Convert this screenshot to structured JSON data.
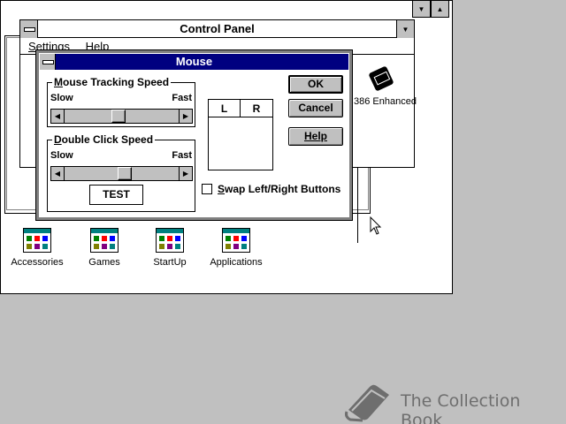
{
  "control_panel": {
    "title": "Control Panel",
    "menu": [
      "Settings",
      "Help"
    ],
    "icon_label": "386 Enhanced"
  },
  "program_groups": [
    {
      "label": "Accessories"
    },
    {
      "label": "Games"
    },
    {
      "label": "StartUp"
    },
    {
      "label": "Applications"
    }
  ],
  "mouse_dialog": {
    "title": "Mouse",
    "tracking": {
      "title": "Mouse Tracking Speed",
      "slow": "Slow",
      "fast": "Fast",
      "value_fraction": 0.47
    },
    "double_click": {
      "title": "Double Click Speed",
      "slow": "Slow",
      "fast": "Fast",
      "value_fraction": 0.53
    },
    "test_label": "TEST",
    "buttons": {
      "left": "L",
      "right": "R"
    },
    "ok": "OK",
    "cancel": "Cancel",
    "help": "Help",
    "swap_label": "Swap Left/Right Buttons",
    "swap_checked": false
  },
  "watermark": "The Collection Book"
}
